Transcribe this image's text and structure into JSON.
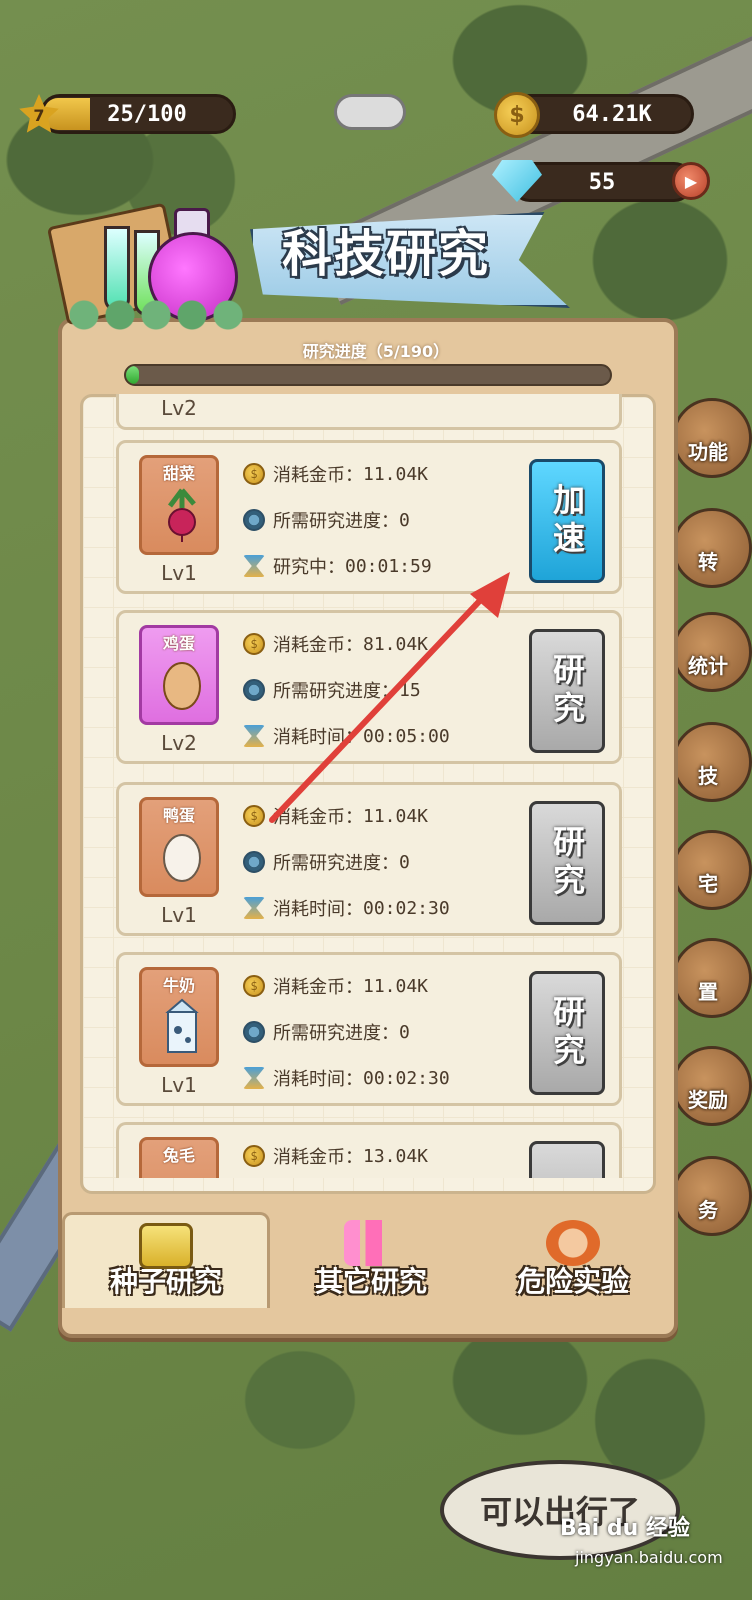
{
  "hud": {
    "level": "7",
    "xp": "25/100",
    "xp_progress": 0.25,
    "coins": "64.21K",
    "gems": "55"
  },
  "title": "科技研究",
  "progress": {
    "label": "研究进度（5/190）",
    "value": 5,
    "max": 190
  },
  "partial_top_card": {
    "level": "Lv2"
  },
  "cards": [
    {
      "name": "甜菜",
      "level": "Lv1",
      "cost_label": "消耗金币：",
      "cost": "11.04K",
      "req_label": "所需研究进度：",
      "req": "0",
      "time_label": "研究中：",
      "time": "00:01:59",
      "button": "加速",
      "icon": "beet-icon",
      "color": "#d98b5e",
      "active": true
    },
    {
      "name": "鸡蛋",
      "level": "Lv2",
      "cost_label": "消耗金币：",
      "cost": "81.04K",
      "req_label": "所需研究进度：",
      "req": "15",
      "time_label": "消耗时间：",
      "time": "00:05:00",
      "button": "研究",
      "icon": "egg-icon",
      "color": "#df6fe0",
      "active": false
    },
    {
      "name": "鸭蛋",
      "level": "Lv1",
      "cost_label": "消耗金币：",
      "cost": "11.04K",
      "req_label": "所需研究进度：",
      "req": "0",
      "time_label": "消耗时间：",
      "time": "00:02:30",
      "button": "研究",
      "icon": "duck-egg-icon",
      "color": "#d98b5e",
      "active": false
    },
    {
      "name": "牛奶",
      "level": "Lv1",
      "cost_label": "消耗金币：",
      "cost": "11.04K",
      "req_label": "所需研究进度：",
      "req": "0",
      "time_label": "消耗时间：",
      "time": "00:02:30",
      "button": "研究",
      "icon": "milk-icon",
      "color": "#d98b5e",
      "active": false
    },
    {
      "name": "兔毛",
      "level": "",
      "cost_label": "消耗金币：",
      "cost": "13.04K",
      "req_label": "",
      "req": "",
      "time_label": "",
      "time": "",
      "button": "",
      "icon": "rabbit-fur-icon",
      "color": "#d98b5e",
      "active": false
    }
  ],
  "tabs": [
    {
      "label": "种子研究",
      "active": true,
      "icon": "seed-bag-icon"
    },
    {
      "label": "其它研究",
      "active": false,
      "icon": "test-tubes-icon"
    },
    {
      "label": "危险实验",
      "active": false,
      "icon": "scientist-icon"
    }
  ],
  "side_menu": [
    "功能",
    "转",
    "统计",
    "技",
    "宅",
    "置",
    "奖励",
    "务"
  ],
  "speech_bubble": "可以出行了",
  "watermark": {
    "brand": "Bai du 经验",
    "url": "jingyan.baidu.com"
  },
  "colors": {
    "accent_blue": "#1fa4d8",
    "progress_green": "#2fa82f",
    "annotation_arrow": "#e0403a"
  }
}
